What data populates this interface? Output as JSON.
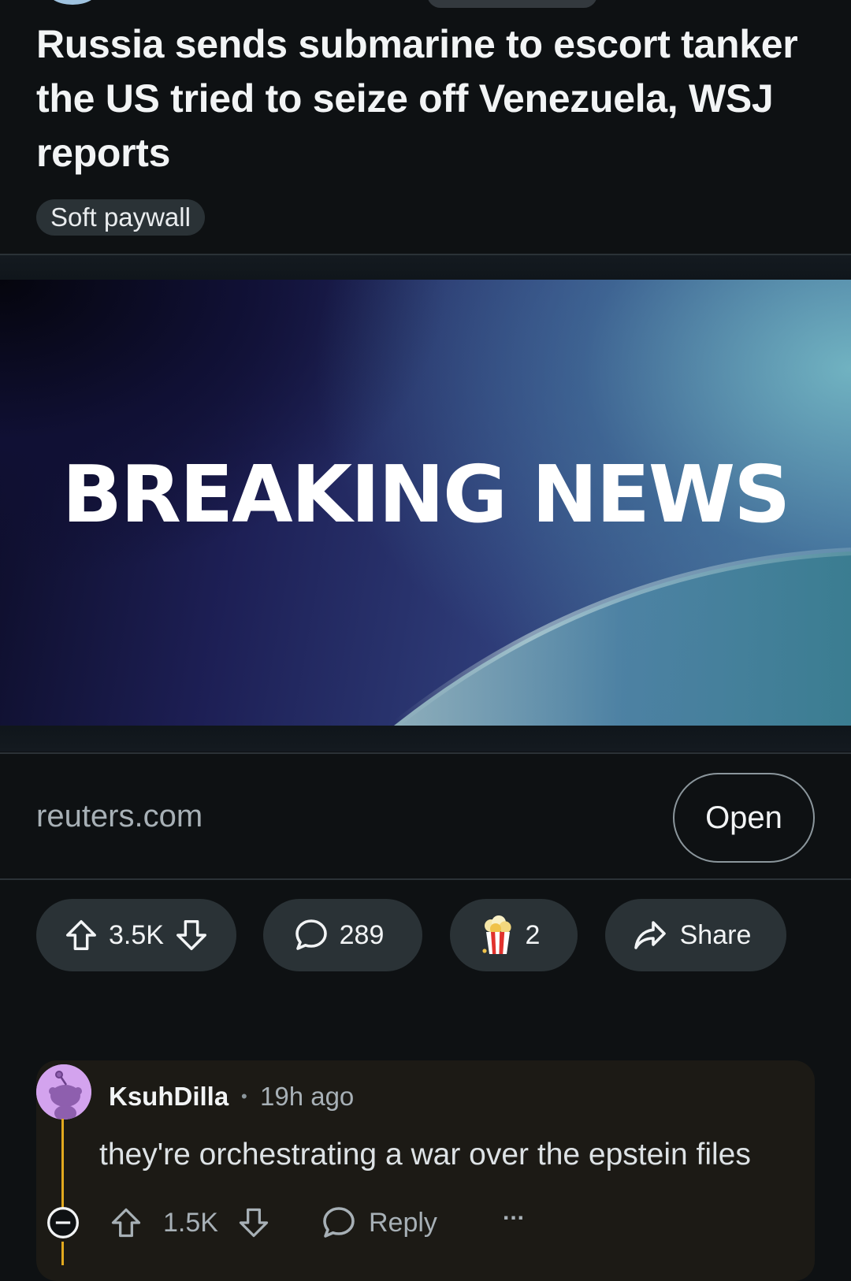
{
  "post": {
    "title": "Russia sends submarine to escort tanker the US tried to seize off Venezuela, WSJ reports",
    "flair": "Soft paywall",
    "media_text": "BREAKING NEWS",
    "source_domain": "reuters.com",
    "open_label": "Open"
  },
  "actions": {
    "vote_count": "3.5K",
    "comment_count": "289",
    "award_count": "2",
    "share_label": "Share"
  },
  "comment": {
    "author": "KsuhDilla",
    "separator": "•",
    "time": "19h ago",
    "body": "they're orchestrating a war over the epstein files",
    "vote_count": "1.5K",
    "reply_label": "Reply",
    "more_label": "..."
  },
  "colors": {
    "background": "#0e1113",
    "pill": "#2a3236",
    "thread_accent": "#e2a91e",
    "avatar": "#d3a3ee"
  }
}
